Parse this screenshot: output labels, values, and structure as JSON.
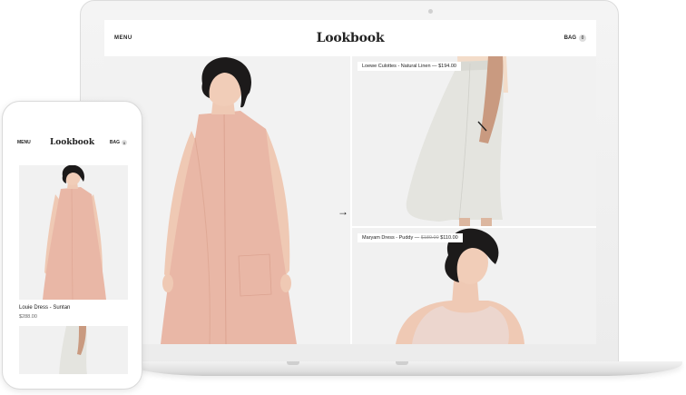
{
  "site": {
    "menu_label": "MENU",
    "logo": "Lookbook",
    "bag_label": "BAG",
    "bag_count": "0"
  },
  "desktop": {
    "arrow": "→",
    "product_top": {
      "caption": "Loewe Culottes - Natural Linen — $194.00"
    },
    "product_bottom": {
      "caption_name": "Maryam Dress - Puddy — ",
      "old_price": "$189.00",
      "price": " $110.00"
    }
  },
  "mobile": {
    "menu_label": "MENU",
    "logo": "Lookbook",
    "bag_label": "BAG",
    "bag_count": "0",
    "product": {
      "name": "Louie Dress - Suntan",
      "price": "$288.00"
    }
  },
  "colors": {
    "dress_pink": "#e9b7a6",
    "background_gray": "#f1f1f1",
    "text": "#222222"
  }
}
